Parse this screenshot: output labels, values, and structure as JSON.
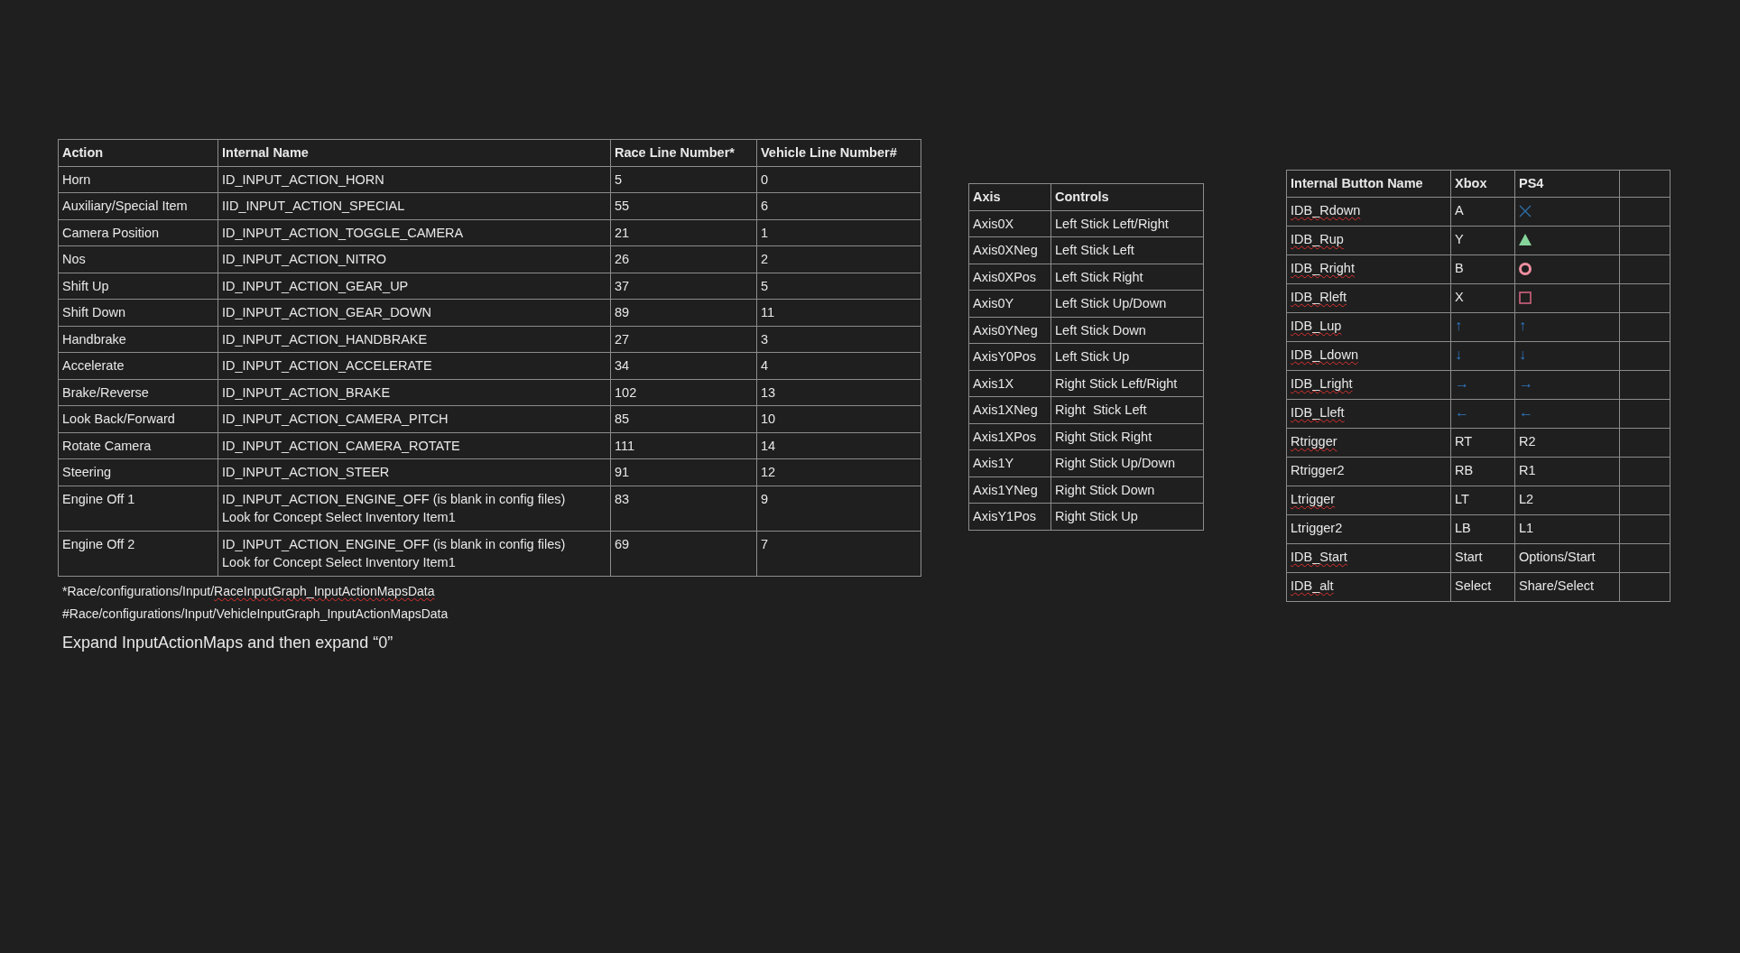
{
  "action_table": {
    "columns": [
      "Action",
      "Internal Name",
      "Race Line Number*",
      "Vehicle Line Number#"
    ],
    "rows": [
      [
        "Horn",
        "ID_INPUT_ACTION_HORN",
        "5",
        "0"
      ],
      [
        "Auxiliary/Special Item",
        "IID_INPUT_ACTION_SPECIAL",
        "55",
        "6"
      ],
      [
        "Camera Position",
        "ID_INPUT_ACTION_TOGGLE_CAMERA",
        "21",
        "1"
      ],
      [
        "Nos",
        "ID_INPUT_ACTION_NITRO",
        "26",
        "2"
      ],
      [
        "Shift Up",
        "ID_INPUT_ACTION_GEAR_UP",
        "37",
        "5"
      ],
      [
        "Shift Down",
        "ID_INPUT_ACTION_GEAR_DOWN",
        "89",
        "11"
      ],
      [
        "Handbrake",
        "ID_INPUT_ACTION_HANDBRAKE",
        "27",
        "3"
      ],
      [
        "Accelerate",
        "ID_INPUT_ACTION_ACCELERATE",
        "34",
        "4"
      ],
      [
        "Brake/Reverse",
        "ID_INPUT_ACTION_BRAKE",
        "102",
        "13"
      ],
      [
        "Look Back/Forward",
        "ID_INPUT_ACTION_CAMERA_PITCH",
        "85",
        "10"
      ],
      [
        "Rotate Camera",
        "ID_INPUT_ACTION_CAMERA_ROTATE",
        "111",
        "14"
      ],
      [
        "Steering",
        "ID_INPUT_ACTION_STEER",
        "91",
        "12"
      ],
      [
        "Engine Off 1",
        "ID_INPUT_ACTION_ENGINE_OFF (is blank in config files)\nLook for Concept Select Inventory Item1",
        "83",
        "9"
      ],
      [
        "Engine Off 2",
        "ID_INPUT_ACTION_ENGINE_OFF (is blank in config files)\nLook for Concept Select Inventory Item1",
        "69",
        "7"
      ]
    ]
  },
  "footnotes": [
    [
      {
        "text": "*Race/configurations/Input/",
        "misspelled": false
      },
      {
        "text": "RaceInputGraph_InputActionMapsData",
        "misspelled": true
      }
    ],
    [
      {
        "text": "#Race/configurations/Input/VehicleInputGraph_InputActionMapsData",
        "misspelled": false
      }
    ]
  ],
  "instruction": "Expand InputActionMaps and then expand “0”",
  "axis_table": {
    "columns": [
      "Axis",
      "Controls"
    ],
    "rows": [
      [
        "Axis0X",
        "Left Stick Left/Right"
      ],
      [
        "Axis0XNeg",
        "Left Stick Left"
      ],
      [
        "Axis0XPos",
        "Left Stick Right"
      ],
      [
        "Axis0Y",
        "Left Stick Up/Down"
      ],
      [
        "Axis0YNeg",
        "Left Stick Down"
      ],
      [
        "AxisY0Pos",
        "Left Stick Up"
      ],
      [
        "Axis1X",
        "Right Stick Left/Right"
      ],
      [
        "Axis1XNeg",
        "Right  Stick Left"
      ],
      [
        "Axis1XPos",
        "Right Stick Right"
      ],
      [
        "Axis1Y",
        "Right Stick Up/Down"
      ],
      [
        "Axis1YNeg",
        "Right Stick Down"
      ],
      [
        "AxisY1Pos",
        "Right Stick Up"
      ]
    ]
  },
  "button_table": {
    "columns": [
      "Internal Button Name",
      "Xbox",
      "PS4"
    ],
    "rows": [
      {
        "name": {
          "text": "IDB_Rdown",
          "misspelled": true
        },
        "xbox": {
          "kind": "text",
          "text": "A"
        },
        "ps4": {
          "kind": "cross"
        }
      },
      {
        "name": {
          "text": "IDB_Rup",
          "misspelled": true
        },
        "xbox": {
          "kind": "text",
          "text": "Y"
        },
        "ps4": {
          "kind": "triangle"
        }
      },
      {
        "name": {
          "text": "IDB_Rright",
          "misspelled": true
        },
        "xbox": {
          "kind": "text",
          "text": "B"
        },
        "ps4": {
          "kind": "circle"
        }
      },
      {
        "name": {
          "text": "IDB_Rleft",
          "misspelled": true
        },
        "xbox": {
          "kind": "text",
          "text": "X"
        },
        "ps4": {
          "kind": "square"
        }
      },
      {
        "name": {
          "text": "IDB_Lup",
          "misspelled": true
        },
        "xbox": {
          "kind": "arrow",
          "text": "↑"
        },
        "ps4": {
          "kind": "arrow",
          "text": "↑"
        }
      },
      {
        "name": {
          "text": "IDB_Ldown",
          "misspelled": true
        },
        "xbox": {
          "kind": "arrow",
          "text": "↓"
        },
        "ps4": {
          "kind": "arrow",
          "text": "↓"
        }
      },
      {
        "name": {
          "text": "IDB_Lright",
          "misspelled": true
        },
        "xbox": {
          "kind": "arrow",
          "text": "→"
        },
        "ps4": {
          "kind": "arrow",
          "text": "→"
        }
      },
      {
        "name": {
          "text": "IDB_Lleft",
          "misspelled": true
        },
        "xbox": {
          "kind": "arrow",
          "text": "←"
        },
        "ps4": {
          "kind": "arrow",
          "text": "←"
        }
      },
      {
        "name": {
          "text": "Rtrigger",
          "misspelled": true
        },
        "xbox": {
          "kind": "text",
          "text": "RT"
        },
        "ps4": {
          "kind": "text",
          "text": "R2"
        }
      },
      {
        "name": {
          "text": "Rtrigger2",
          "misspelled": false
        },
        "xbox": {
          "kind": "text",
          "text": "RB"
        },
        "ps4": {
          "kind": "text",
          "text": "R1"
        }
      },
      {
        "name": {
          "text": "Ltrigger",
          "misspelled": true
        },
        "xbox": {
          "kind": "text",
          "text": "LT"
        },
        "ps4": {
          "kind": "text",
          "text": "L2"
        }
      },
      {
        "name": {
          "text": "Ltrigger2",
          "misspelled": false
        },
        "xbox": {
          "kind": "text",
          "text": "LB"
        },
        "ps4": {
          "kind": "text",
          "text": "L1"
        }
      },
      {
        "name": {
          "text": "IDB_Start",
          "misspelled": true
        },
        "xbox": {
          "kind": "text",
          "text": "Start"
        },
        "ps4": {
          "kind": "text",
          "text": "Options/Start"
        }
      },
      {
        "name": {
          "text": "IDB_alt",
          "misspelled": true
        },
        "xbox": {
          "kind": "text",
          "text": "Select"
        },
        "ps4": {
          "kind": "text",
          "text": "Share/Select"
        }
      }
    ]
  }
}
